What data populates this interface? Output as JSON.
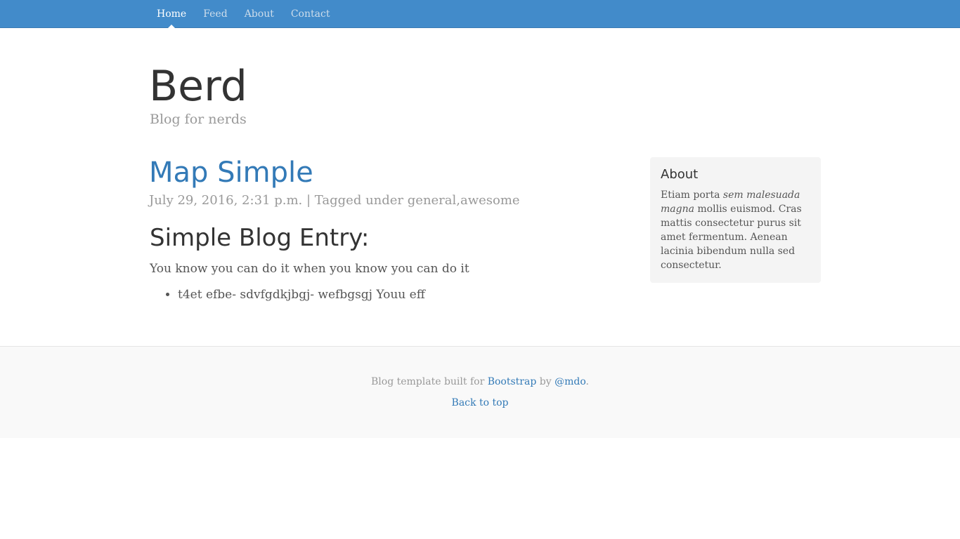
{
  "nav": {
    "items": [
      {
        "label": "Home",
        "active": true
      },
      {
        "label": "Feed",
        "active": false
      },
      {
        "label": "About",
        "active": false
      },
      {
        "label": "Contact",
        "active": false
      }
    ]
  },
  "header": {
    "title": "Berd",
    "description": "Blog for nerds"
  },
  "post": {
    "title": "Map Simple",
    "date": "July 29, 2016, 2:31 p.m.",
    "separator": "|",
    "tagged_label": "Tagged under",
    "tags": "general,awesome",
    "heading": "Simple Blog Entry:",
    "paragraph": "You know you can do it when you know you can do it",
    "list_items": [
      "t4et efbe- sdvfgdkjbgj- wefbgsgj Youu eff"
    ]
  },
  "sidebar": {
    "title": "About",
    "text_before": "Etiam porta ",
    "text_italic": "sem malesuada magna",
    "text_after": " mollis euismod. Cras mattis consectetur purus sit amet fermentum. Aenean lacinia bibendum nulla sed consectetur."
  },
  "footer": {
    "prefix": "Blog template built for ",
    "bootstrap_link": "Bootstrap",
    "by": " by ",
    "author_link": "@mdo",
    "suffix": ".",
    "back_to_top": "Back to top"
  },
  "colors": {
    "navbar": "#428bca",
    "link": "#337ab7",
    "muted": "#999999",
    "sidebar_bg": "#f4f4f4",
    "footer_bg": "#f9f9f9"
  }
}
